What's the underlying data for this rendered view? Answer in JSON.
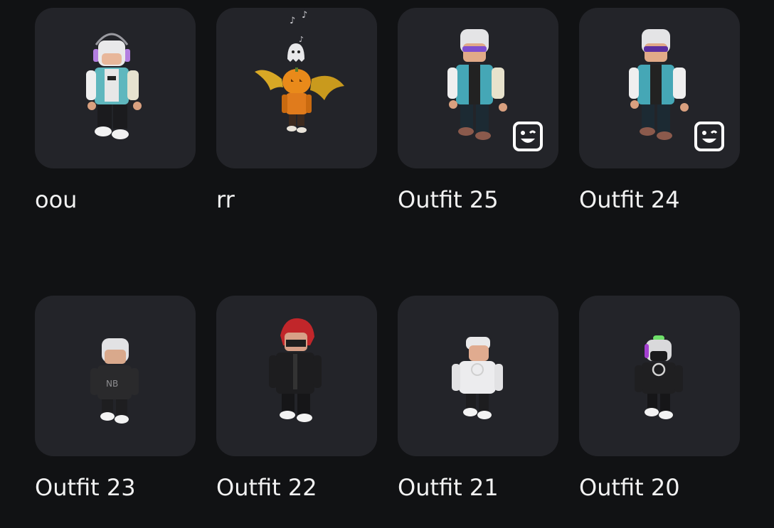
{
  "outfits": [
    {
      "name": "oou",
      "avatar": "avatar-headphones-teal-vest",
      "has_emote_badge": false
    },
    {
      "name": "rr",
      "avatar": "avatar-pumpkin-bat-wings",
      "has_emote_badge": false
    },
    {
      "name": "Outfit 25",
      "avatar": "avatar-sunglasses-teal-jacket",
      "has_emote_badge": true
    },
    {
      "name": "Outfit 24",
      "avatar": "avatar-sunglasses-teal-jacket",
      "has_emote_badge": true
    },
    {
      "name": "Outfit 23",
      "avatar": "avatar-white-hair-black-hoodie",
      "has_emote_badge": false
    },
    {
      "name": "Outfit 22",
      "avatar": "avatar-red-hair-black-suit",
      "has_emote_badge": false
    },
    {
      "name": "Outfit 21",
      "avatar": "avatar-white-cap-white-shirt",
      "has_emote_badge": false
    },
    {
      "name": "Outfit 20",
      "avatar": "avatar-green-hair-black-outfit",
      "has_emote_badge": false
    }
  ],
  "colors": {
    "background": "#111214",
    "card": "#232429",
    "text": "#f2f2f2"
  },
  "icons": {
    "emote_badge": "smiley-face-icon"
  }
}
